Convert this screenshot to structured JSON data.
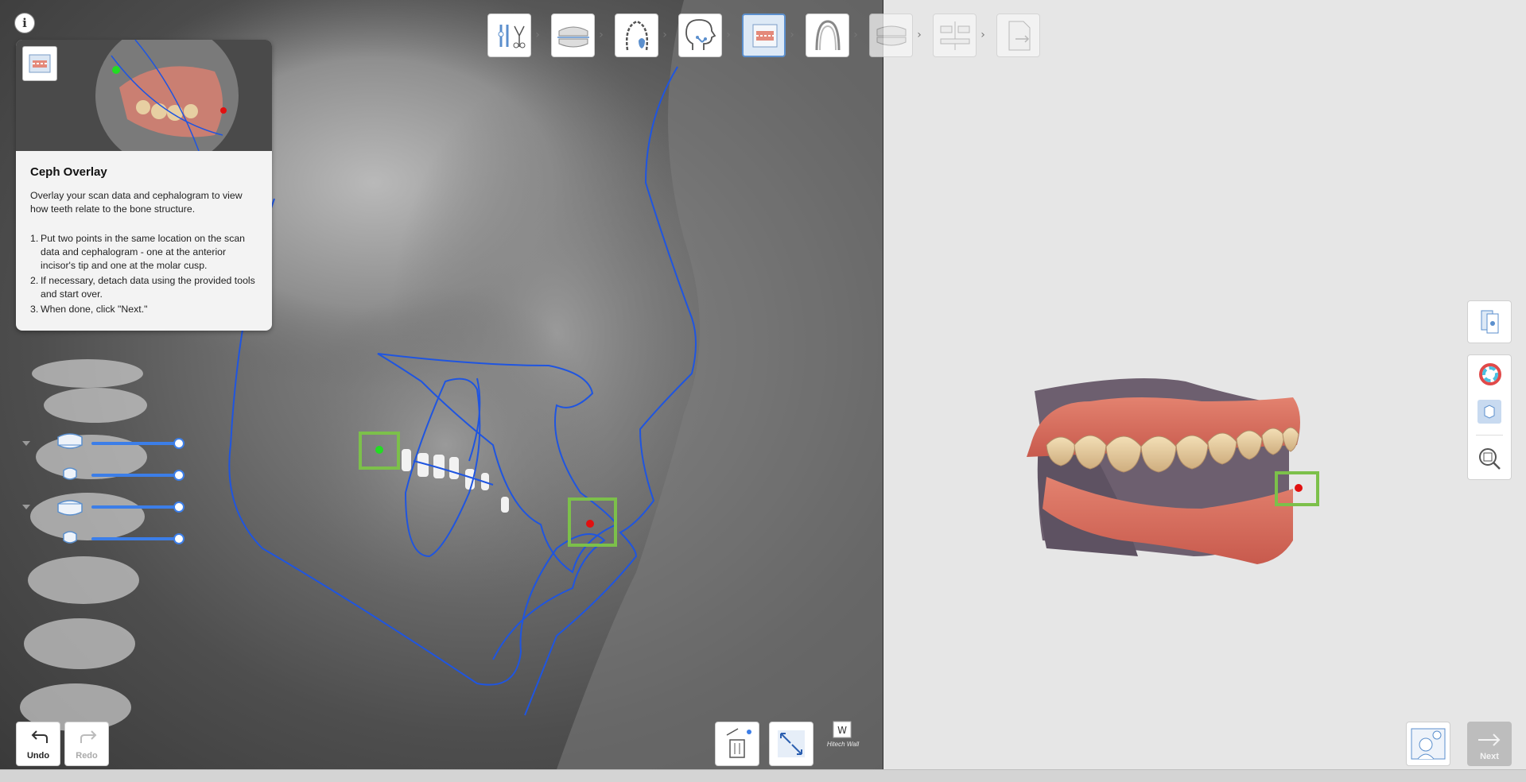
{
  "info": {
    "label": "i"
  },
  "guide": {
    "title": "Ceph Overlay",
    "description": "Overlay your scan data and cephalogram to view how teeth relate to the bone structure.",
    "steps": [
      {
        "num": "1.",
        "text": "Put two points in the same location on the scan data and cephalogram - one at the anterior incisor's tip and one at the molar cusp."
      },
      {
        "num": "2.",
        "text": "If necessary, detach data using the provided tools and start over."
      },
      {
        "num": "3.",
        "text": "When done, click \"Next.\""
      }
    ]
  },
  "workflow_steps": [
    {
      "icon": "tools-icon",
      "state": "done"
    },
    {
      "icon": "arch-scan-icon",
      "state": "done"
    },
    {
      "icon": "tooth-segmentation-icon",
      "state": "done"
    },
    {
      "icon": "ceph-head-icon",
      "state": "done"
    },
    {
      "icon": "ceph-overlay-icon",
      "state": "active"
    },
    {
      "icon": "occlusal-arch-icon",
      "state": "pending"
    },
    {
      "icon": "bite-setup-icon",
      "state": "disabled"
    },
    {
      "icon": "arch-compare-icon",
      "state": "disabled"
    },
    {
      "icon": "report-export-icon",
      "state": "disabled"
    }
  ],
  "opacity_sliders": [
    {
      "icon": "upper-jaw-icon",
      "value": 1.0
    },
    {
      "icon": "upper-teeth-icon",
      "value": 1.0
    },
    {
      "icon": "lower-jaw-icon",
      "value": 1.0
    },
    {
      "icon": "lower-teeth-icon",
      "value": 1.0
    }
  ],
  "bottom_left": {
    "undo_label": "Undo",
    "redo_label": "Redo"
  },
  "ceph_tools": {
    "brand_label": "Hitech Wall"
  },
  "right_tools": [
    "view-direction-icon",
    "color-palette-icon",
    "cube-view-icon",
    "zoom-fit-icon"
  ],
  "bottom_right": {
    "next_label": "Next"
  },
  "colors": {
    "accent": "#3c7ee8",
    "marker": "#7cc04a",
    "point_green": "#22dd22",
    "point_red": "#e11010",
    "active_step": "#5b8fcd"
  }
}
